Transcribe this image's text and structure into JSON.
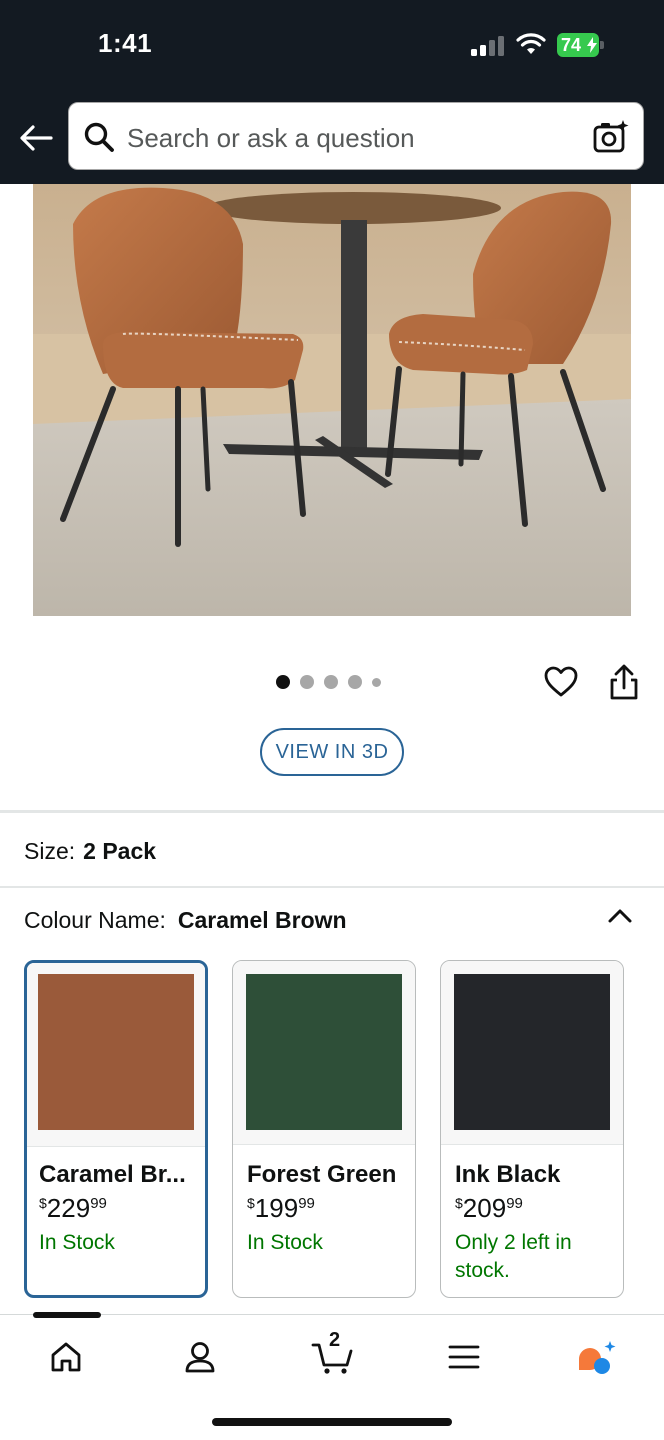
{
  "status_bar": {
    "time": "1:41",
    "battery": "74"
  },
  "search": {
    "placeholder": "Search or ask a question"
  },
  "gallery": {
    "dot_count": 5,
    "active_index": 0
  },
  "view_3d_label": "VIEW IN 3D",
  "size": {
    "label": "Size:",
    "value": "2 Pack"
  },
  "colour": {
    "label": "Colour Name:",
    "value": "Caramel Brown",
    "options": [
      {
        "name": "Caramel Br...",
        "price_symbol": "$",
        "price_whole": "229",
        "price_cents": "99",
        "stock": "In Stock",
        "color": "#9a5a3a",
        "selected": true
      },
      {
        "name": "Forest Green",
        "price_symbol": "$",
        "price_whole": "199",
        "price_cents": "99",
        "stock": "In Stock",
        "color": "#2e4f38",
        "selected": false
      },
      {
        "name": "Ink Black",
        "price_symbol": "$",
        "price_whole": "209",
        "price_cents": "99",
        "stock": "Only 2 left in stock.",
        "color": "#24262a",
        "selected": false
      }
    ]
  },
  "bottom_nav": {
    "items": [
      "home-icon",
      "account-icon",
      "cart-icon",
      "menu-icon",
      "rufus-icon"
    ],
    "cart_count": "2"
  },
  "colors": {
    "header_bg": "#131a22",
    "accent_blue": "#2a6496",
    "in_stock_green": "#007600",
    "battery_green": "#36c94e"
  }
}
